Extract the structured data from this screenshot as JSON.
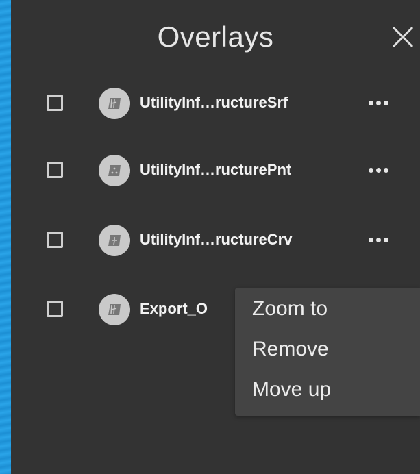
{
  "panel": {
    "title": "Overlays"
  },
  "layers": [
    {
      "name": "UtilityInf…ructureSrf",
      "icon": "surface-layer-icon",
      "show_more": true
    },
    {
      "name": "UtilityInf…ructurePnt",
      "icon": "point-layer-icon",
      "show_more": true
    },
    {
      "name": "UtilityInf…ructureCrv",
      "icon": "curve-layer-icon",
      "show_more": true
    },
    {
      "name": "Export_O",
      "icon": "surface-layer-icon",
      "show_more": false
    }
  ],
  "context_menu": {
    "items": [
      "Zoom to",
      "Remove",
      "Move up"
    ]
  },
  "colors": {
    "panel_bg": "#333333",
    "menu_bg": "#444444",
    "text": "#f2f2f2",
    "icon_bg": "#c9c9c9",
    "background_blue": "#1a9be6"
  }
}
